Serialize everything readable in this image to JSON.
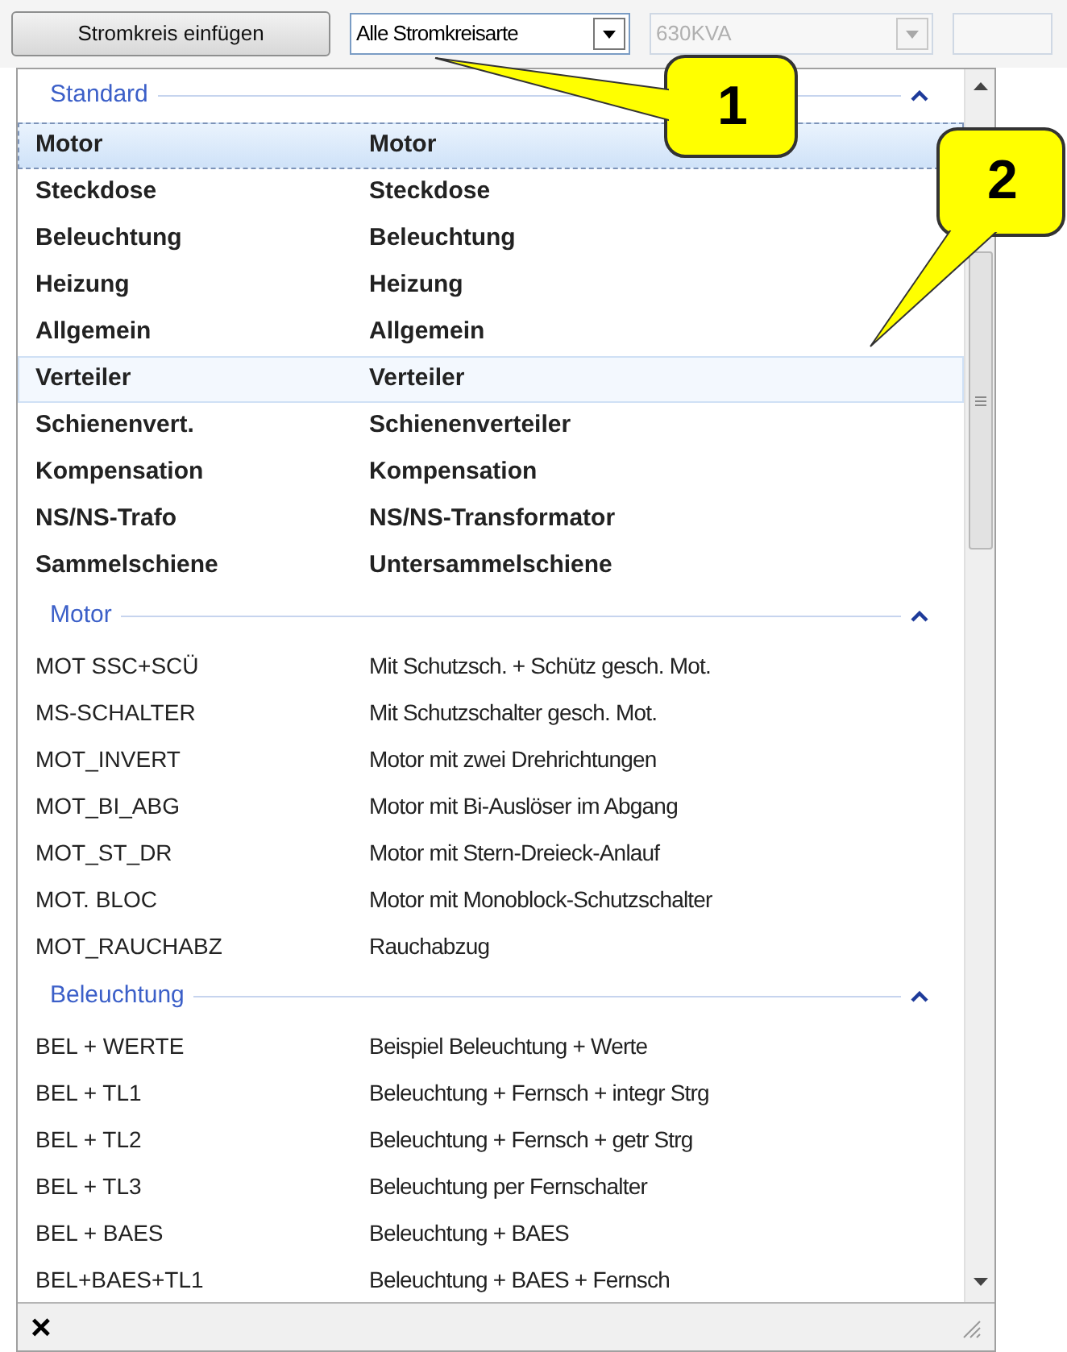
{
  "toolbar": {
    "insert_button": "Stromkreis einfügen",
    "type_combo": {
      "value": "Alle Stromkreisarte"
    },
    "rating_combo": {
      "value": "630KVA",
      "disabled": true
    }
  },
  "sections": [
    {
      "title": "Standard",
      "expanded": true,
      "bold": true,
      "items": [
        {
          "code": "Motor",
          "description": "Motor",
          "selected": true,
          "hovered": false
        },
        {
          "code": "Steckdose",
          "description": "Steckdose",
          "selected": false,
          "hovered": false
        },
        {
          "code": "Beleuchtung",
          "description": "Beleuchtung",
          "selected": false,
          "hovered": false
        },
        {
          "code": "Heizung",
          "description": "Heizung",
          "selected": false,
          "hovered": false
        },
        {
          "code": "Allgemein",
          "description": "Allgemein",
          "selected": false,
          "hovered": false
        },
        {
          "code": "Verteiler",
          "description": "Verteiler",
          "selected": false,
          "hovered": true
        },
        {
          "code": "Schienenvert.",
          "description": "Schienenverteiler",
          "selected": false,
          "hovered": false
        },
        {
          "code": "Kompensation",
          "description": "Kompensation",
          "selected": false,
          "hovered": false
        },
        {
          "code": "NS/NS-Trafo",
          "description": "NS/NS-Transformator",
          "selected": false,
          "hovered": false
        },
        {
          "code": "Sammelschiene",
          "description": "Untersammelschiene",
          "selected": false,
          "hovered": false
        }
      ]
    },
    {
      "title": "Motor",
      "expanded": true,
      "bold": false,
      "items": [
        {
          "code": "MOT SSC+SCÜ",
          "description": "Mit Schutzsch. + Schütz gesch. Mot.",
          "selected": false,
          "hovered": false
        },
        {
          "code": "MS-SCHALTER",
          "description": "Mit Schutzschalter gesch. Mot.",
          "selected": false,
          "hovered": false
        },
        {
          "code": "MOT_INVERT",
          "description": "Motor mit zwei Drehrichtungen",
          "selected": false,
          "hovered": false
        },
        {
          "code": "MOT_BI_ABG",
          "description": "Motor mit Bi-Auslöser im Abgang",
          "selected": false,
          "hovered": false
        },
        {
          "code": "MOT_ST_DR",
          "description": "Motor mit Stern-Dreieck-Anlauf",
          "selected": false,
          "hovered": false
        },
        {
          "code": "MOT. BLOC",
          "description": "Motor mit Monoblock-Schutzschalter",
          "selected": false,
          "hovered": false
        },
        {
          "code": "MOT_RAUCHABZ",
          "description": "Rauchabzug",
          "selected": false,
          "hovered": false
        }
      ]
    },
    {
      "title": "Beleuchtung",
      "expanded": true,
      "bold": false,
      "items": [
        {
          "code": "BEL + WERTE",
          "description": "Beispiel Beleuchtung + Werte",
          "selected": false,
          "hovered": false
        },
        {
          "code": "BEL + TL1",
          "description": "Beleuchtung + Fernsch + integr Strg",
          "selected": false,
          "hovered": false
        },
        {
          "code": "BEL + TL2",
          "description": "Beleuchtung + Fernsch + getr Strg",
          "selected": false,
          "hovered": false
        },
        {
          "code": "BEL + TL3",
          "description": "Beleuchtung per Fernschalter",
          "selected": false,
          "hovered": false
        },
        {
          "code": "BEL + BAES",
          "description": "Beleuchtung + BAES",
          "selected": false,
          "hovered": false
        },
        {
          "code": "BEL+BAES+TL1",
          "description": "Beleuchtung + BAES + Fernsch",
          "selected": false,
          "hovered": false
        }
      ]
    }
  ],
  "footer": {
    "close": "×"
  },
  "callouts": [
    {
      "number": "1"
    },
    {
      "number": "2"
    }
  ]
}
